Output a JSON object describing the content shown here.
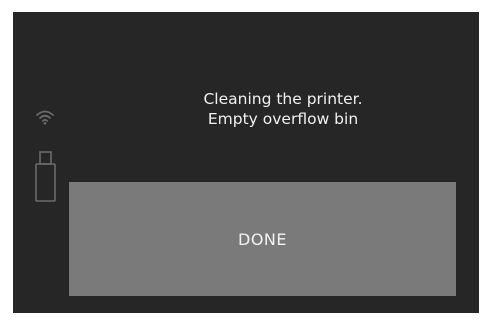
{
  "status": {
    "wifi_icon": "wifi-icon",
    "usb_icon": "usb-drive-icon"
  },
  "message": {
    "line1": "Cleaning the printer.",
    "line2": "Empty overflow bin"
  },
  "actions": {
    "done_label": "DONE"
  },
  "colors": {
    "screen_background": "#262626",
    "button_background": "#7a7a7a",
    "text": "#f0f0f0",
    "icon": "#6a6a6a"
  }
}
